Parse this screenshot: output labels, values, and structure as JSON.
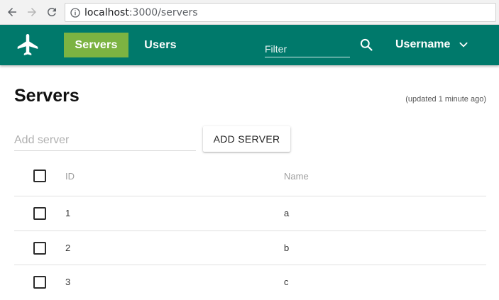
{
  "browser": {
    "url_host": "localhost",
    "url_path": ":3000/servers",
    "icons": {
      "back": "arrow-left-icon",
      "forward": "arrow-right-icon",
      "reload": "reload-icon",
      "info": "info-icon"
    }
  },
  "header": {
    "brand_icon": "airplane-icon",
    "tabs": [
      {
        "label": "Servers",
        "active": true
      },
      {
        "label": "Users",
        "active": false
      }
    ],
    "filter_placeholder": "Filter",
    "search_icon": "search-icon",
    "username": "Username",
    "user_menu_icon": "chevron-down-icon",
    "colors": {
      "bar": "#00796b",
      "active_tab": "#7cb342"
    }
  },
  "main": {
    "title": "Servers",
    "updated_text": "(updated 1 minute ago)",
    "add_placeholder": "Add server",
    "add_button_label": "ADD SERVER",
    "table": {
      "columns": [
        "ID",
        "Name"
      ],
      "rows": [
        {
          "id": "1",
          "name": "a"
        },
        {
          "id": "2",
          "name": "b"
        },
        {
          "id": "3",
          "name": "c"
        }
      ]
    }
  }
}
